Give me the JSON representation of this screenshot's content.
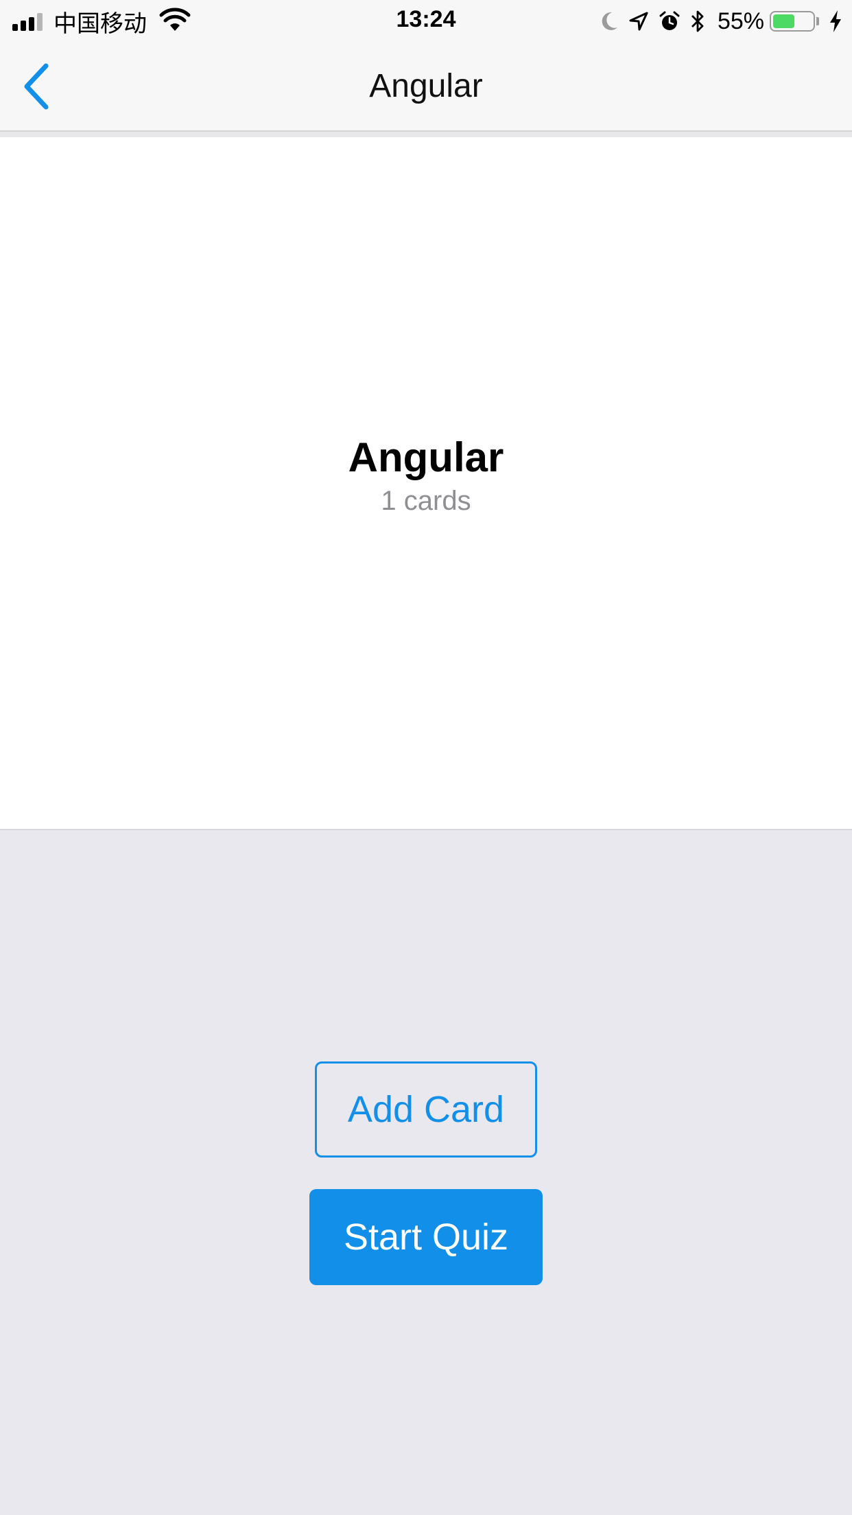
{
  "status_bar": {
    "carrier": "中国移动",
    "time": "13:24",
    "battery_percent": "55%",
    "battery_level": 0.55,
    "icons": [
      "signal-icon",
      "wifi-icon",
      "moon-icon",
      "location-icon",
      "alarm-icon",
      "bluetooth-icon",
      "battery-icon",
      "charging-icon"
    ]
  },
  "nav": {
    "title": "Angular",
    "back_icon": "chevron-left-icon"
  },
  "deck": {
    "title": "Angular",
    "count_text": "1 cards"
  },
  "actions": {
    "add_card_label": "Add Card",
    "start_quiz_label": "Start Quiz"
  },
  "colors": {
    "accent": "#128fe8",
    "background": "#e9e8ee",
    "panel": "#ffffff",
    "muted_text": "#8e8e93",
    "battery_fill": "#4cd964"
  }
}
